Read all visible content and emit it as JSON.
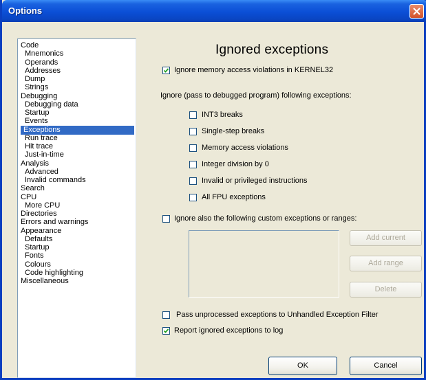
{
  "window": {
    "title": "Options"
  },
  "tree": {
    "items": [
      {
        "label": "Code",
        "level": 0
      },
      {
        "label": "Mnemonics",
        "level": 1
      },
      {
        "label": "Operands",
        "level": 1
      },
      {
        "label": "Addresses",
        "level": 1
      },
      {
        "label": "Dump",
        "level": 1
      },
      {
        "label": "Strings",
        "level": 1
      },
      {
        "label": "Debugging",
        "level": 0
      },
      {
        "label": "Debugging data",
        "level": 1
      },
      {
        "label": "Startup",
        "level": 1
      },
      {
        "label": "Events",
        "level": 1
      },
      {
        "label": "Exceptions",
        "level": 1,
        "selected": true
      },
      {
        "label": "Run trace",
        "level": 1
      },
      {
        "label": "Hit trace",
        "level": 1
      },
      {
        "label": "Just-in-time",
        "level": 1
      },
      {
        "label": "Analysis",
        "level": 0
      },
      {
        "label": "Advanced",
        "level": 1
      },
      {
        "label": "Invalid commands",
        "level": 1
      },
      {
        "label": "Search",
        "level": 0
      },
      {
        "label": "CPU",
        "level": 0
      },
      {
        "label": "More CPU",
        "level": 1
      },
      {
        "label": "Directories",
        "level": 0
      },
      {
        "label": "Errors and warnings",
        "level": 0
      },
      {
        "label": "Appearance",
        "level": 0
      },
      {
        "label": "Defaults",
        "level": 1
      },
      {
        "label": "Startup",
        "level": 1
      },
      {
        "label": "Fonts",
        "level": 1
      },
      {
        "label": "Colours",
        "level": 1
      },
      {
        "label": "Code highlighting",
        "level": 1
      },
      {
        "label": "Miscellaneous",
        "level": 0
      }
    ]
  },
  "panel": {
    "title": "Ignored exceptions",
    "ignore_kernel32": {
      "label": "Ignore memory access violations in KERNEL32",
      "checked": true
    },
    "pass_heading": "Ignore (pass to debugged program) following exceptions:",
    "exceptions": [
      {
        "label": "INT3 breaks",
        "checked": false
      },
      {
        "label": "Single-step breaks",
        "checked": false
      },
      {
        "label": "Memory access violations",
        "checked": false
      },
      {
        "label": "Integer division by 0",
        "checked": false
      },
      {
        "label": "Invalid or privileged instructions",
        "checked": false
      },
      {
        "label": "All FPU exceptions",
        "checked": false
      }
    ],
    "custom": {
      "label": "Ignore also the following custom exceptions or ranges:",
      "checked": false
    },
    "buttons": {
      "add_current": "Add current",
      "add_range": "Add range",
      "delete": "Delete"
    },
    "pass_unprocessed": {
      "label": "Pass unprocessed exceptions to Unhandled Exception Filter",
      "checked": false
    },
    "report_log": {
      "label": "Report ignored exceptions to log",
      "checked": true
    }
  },
  "footer": {
    "ok": "OK",
    "cancel": "Cancel"
  },
  "colors": {
    "title_bar": "#0b4fd6",
    "selection": "#316ac5",
    "dialog_bg": "#ece9d8"
  }
}
